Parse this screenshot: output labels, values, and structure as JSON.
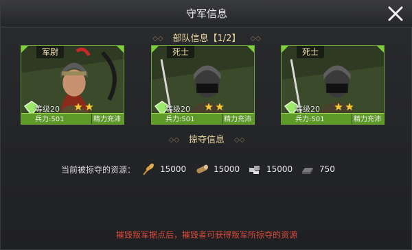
{
  "title": "守军信息",
  "troops_section": {
    "label": "部队信息【1/2】"
  },
  "cards": [
    {
      "rank": "军尉",
      "level": "等级20",
      "stars": 2,
      "troop": "兵力:501",
      "food": "精力充沛"
    },
    {
      "rank": "死士",
      "level": "等级20",
      "stars": 2,
      "troop": "兵力:501",
      "food": "精力充沛"
    },
    {
      "rank": "死士",
      "level": "等级20",
      "stars": 2,
      "troop": "兵力:501",
      "food": "精力充沛"
    }
  ],
  "loot_section": {
    "label": "掠夺信息"
  },
  "loot": {
    "label": "当前被掠夺的资源：",
    "resources": [
      {
        "icon": "grain-icon",
        "value": "15000"
      },
      {
        "icon": "wood-icon",
        "value": "15000"
      },
      {
        "icon": "stone-icon",
        "value": "15000"
      },
      {
        "icon": "iron-icon",
        "value": "750"
      }
    ]
  },
  "footer": "摧毁叛军据点后，摧毁者可获得叛军所掠夺的资源",
  "colors": {
    "accent": "#7ccf3a",
    "title": "#e8d49c",
    "warning": "#d84a3a"
  }
}
